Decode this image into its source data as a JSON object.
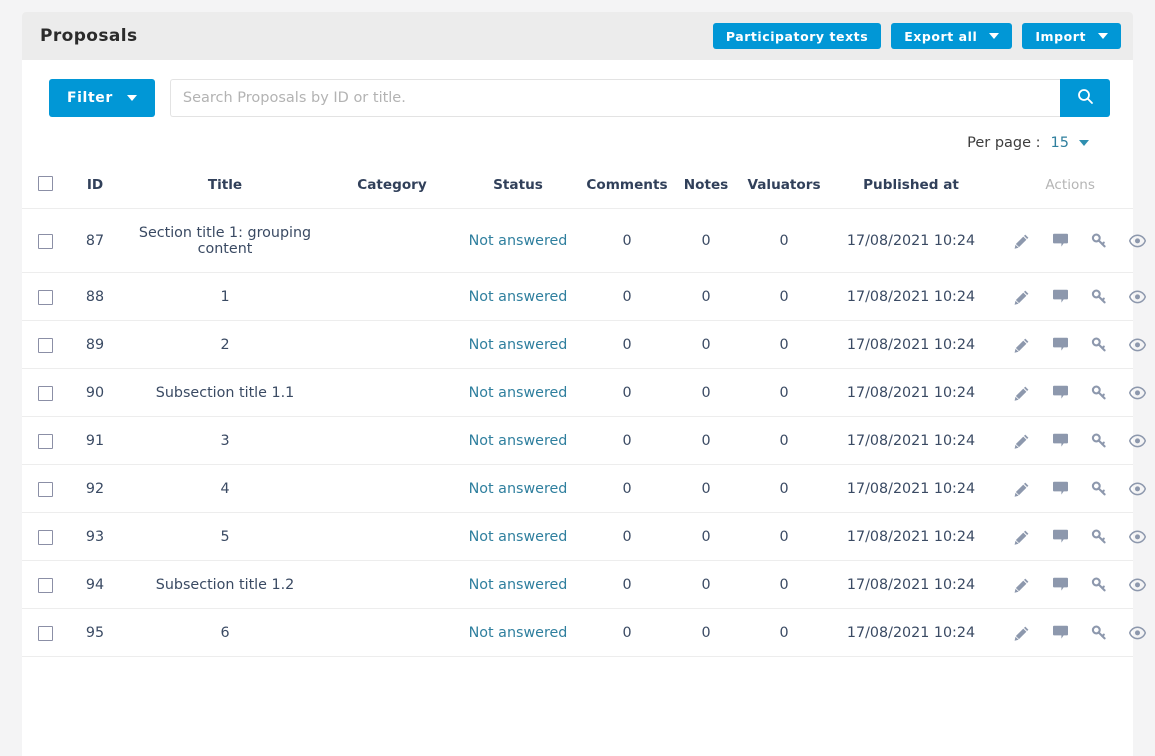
{
  "header": {
    "title": "Proposals",
    "buttons": [
      {
        "label": "Participatory texts",
        "icon": "none"
      },
      {
        "label": "Export all",
        "icon": "chevron-down-icon"
      },
      {
        "label": "Import",
        "icon": "chevron-down-icon"
      }
    ]
  },
  "toolbar": {
    "filter_label": "Filter",
    "search_placeholder": "Search Proposals by ID or title.",
    "search_value": "",
    "search_icon": "search-icon"
  },
  "per_page": {
    "label": "Per page :",
    "value": "15"
  },
  "table": {
    "columns": [
      "ID",
      "Title",
      "Category",
      "Status",
      "Comments",
      "Notes",
      "Valuators",
      "Published at",
      "Actions"
    ],
    "row_actions": [
      "edit-pencil-icon",
      "comment-icon",
      "key-icon",
      "preview-eye-icon"
    ],
    "rows": [
      {
        "id": "87",
        "title": "Section title 1: grouping content",
        "category": "",
        "status": "Not answered",
        "comments": "0",
        "notes": "0",
        "valuators": "0",
        "published_at": "17/08/2021 10:24"
      },
      {
        "id": "88",
        "title": "1",
        "category": "",
        "status": "Not answered",
        "comments": "0",
        "notes": "0",
        "valuators": "0",
        "published_at": "17/08/2021 10:24"
      },
      {
        "id": "89",
        "title": "2",
        "category": "",
        "status": "Not answered",
        "comments": "0",
        "notes": "0",
        "valuators": "0",
        "published_at": "17/08/2021 10:24"
      },
      {
        "id": "90",
        "title": "Subsection title 1.1",
        "category": "",
        "status": "Not answered",
        "comments": "0",
        "notes": "0",
        "valuators": "0",
        "published_at": "17/08/2021 10:24"
      },
      {
        "id": "91",
        "title": "3",
        "category": "",
        "status": "Not answered",
        "comments": "0",
        "notes": "0",
        "valuators": "0",
        "published_at": "17/08/2021 10:24"
      },
      {
        "id": "92",
        "title": "4",
        "category": "",
        "status": "Not answered",
        "comments": "0",
        "notes": "0",
        "valuators": "0",
        "published_at": "17/08/2021 10:24"
      },
      {
        "id": "93",
        "title": "5",
        "category": "",
        "status": "Not answered",
        "comments": "0",
        "notes": "0",
        "valuators": "0",
        "published_at": "17/08/2021 10:24"
      },
      {
        "id": "94",
        "title": "Subsection title 1.2",
        "category": "",
        "status": "Not answered",
        "comments": "0",
        "notes": "0",
        "valuators": "0",
        "published_at": "17/08/2021 10:24"
      },
      {
        "id": "95",
        "title": "6",
        "category": "",
        "status": "Not answered",
        "comments": "0",
        "notes": "0",
        "valuators": "0",
        "published_at": "17/08/2021 10:24"
      }
    ]
  },
  "colors": {
    "accent": "#0197d6",
    "status_text": "#2f7f9e",
    "header_bg": "#ececec",
    "page_bg": "#f4f4f5",
    "icon_gray": "#8d98ad",
    "actions_label": "#b5b5b5"
  }
}
